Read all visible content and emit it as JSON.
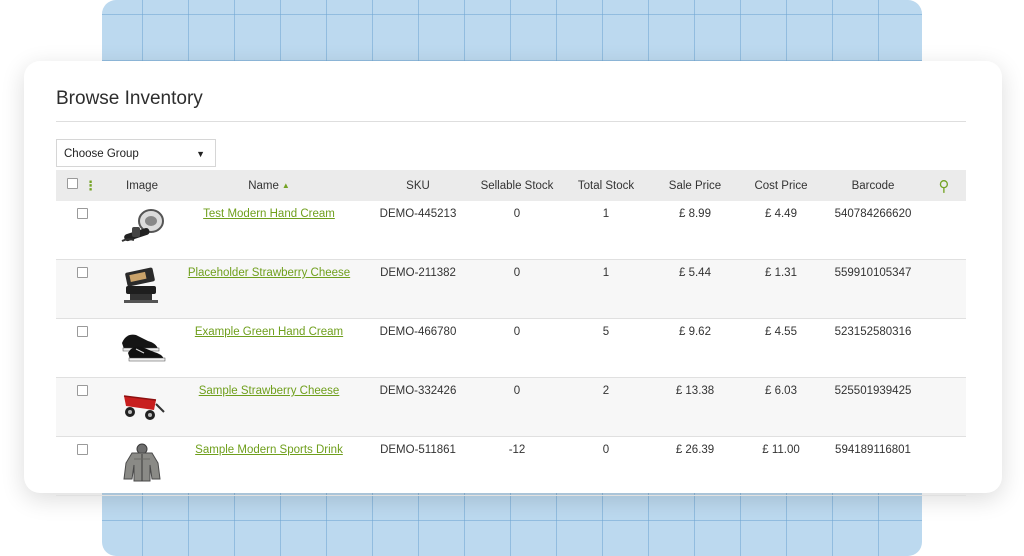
{
  "page": {
    "title": "Browse Inventory"
  },
  "group_select": {
    "value": "Choose Group"
  },
  "columns": {
    "image": "Image",
    "name": "Name",
    "sku": "SKU",
    "sellable": "Sellable Stock",
    "total": "Total Stock",
    "sale": "Sale Price",
    "cost": "Cost Price",
    "barcode": "Barcode"
  },
  "icons": {
    "column_options": "vertical-dots-icon",
    "sort": "sort-ascending-icon",
    "search": "search-icon",
    "select_caret": "caret-down-icon"
  },
  "colors": {
    "accent": "#74a324",
    "link": "#6f9f1c",
    "header_bg": "#ebebeb"
  },
  "rows": [
    {
      "image": "hand-blender-image",
      "name": "Test Modern Hand Cream",
      "sku": "DEMO-445213",
      "sellable": "0",
      "total": "1",
      "sale": "£ 8.99",
      "cost": "£ 4.49",
      "barcode": "540784266620"
    },
    {
      "image": "waffle-maker-image",
      "name": "Placeholder Strawberry Cheese",
      "sku": "DEMO-211382",
      "sellable": "0",
      "total": "1",
      "sale": "£ 5.44",
      "cost": "£ 1.31",
      "barcode": "559910105347"
    },
    {
      "image": "sneakers-image",
      "name": "Example Green Hand Cream",
      "sku": "DEMO-466780",
      "sellable": "0",
      "total": "5",
      "sale": "£ 9.62",
      "cost": "£ 4.55",
      "barcode": "523152580316"
    },
    {
      "image": "red-wagon-image",
      "name": "Sample Strawberry Cheese",
      "sku": "DEMO-332426",
      "sellable": "0",
      "total": "2",
      "sale": "£ 13.38",
      "cost": "£ 6.03",
      "barcode": "525501939425"
    },
    {
      "image": "jacket-image",
      "name": "Sample Modern Sports Drink",
      "sku": "DEMO-511861",
      "sellable": "-12",
      "total": "0",
      "sale": "£ 26.39",
      "cost": "£ 11.00",
      "barcode": "594189116801"
    }
  ]
}
